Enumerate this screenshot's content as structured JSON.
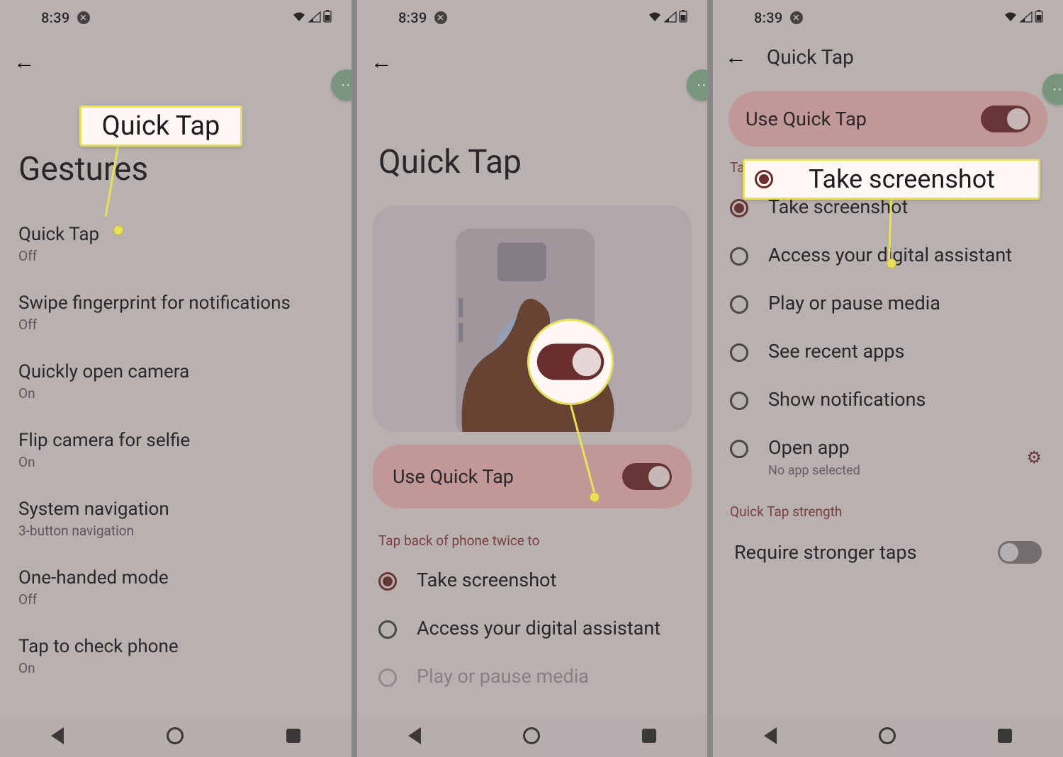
{
  "status_time": "8:39",
  "panel1": {
    "title": "Gestures",
    "items": [
      {
        "title": "Quick Tap",
        "sub": "Off"
      },
      {
        "title": "Swipe fingerprint for notifications",
        "sub": "Off"
      },
      {
        "title": "Quickly open camera",
        "sub": "On"
      },
      {
        "title": "Flip camera for selfie",
        "sub": "On"
      },
      {
        "title": "System navigation",
        "sub": "3-button navigation"
      },
      {
        "title": "One-handed mode",
        "sub": "Off"
      },
      {
        "title": "Tap to check phone",
        "sub": "On"
      }
    ],
    "callout_label": "Quick Tap"
  },
  "panel2": {
    "title": "Quick Tap",
    "use_label": "Use Quick Tap",
    "section": "Tap back of phone twice to",
    "options": [
      {
        "label": "Take screenshot",
        "selected": true
      },
      {
        "label": "Access your digital assistant",
        "selected": false
      },
      {
        "label": "Play or pause media",
        "selected": false
      }
    ]
  },
  "panel3": {
    "appbar_title": "Quick Tap",
    "use_label": "Use Quick Tap",
    "section": "Tap back of phone twice to",
    "options": [
      {
        "label": "Take screenshot",
        "selected": true
      },
      {
        "label": "Access your digital assistant",
        "selected": false
      },
      {
        "label": "Play or pause media",
        "selected": false
      },
      {
        "label": "See recent apps",
        "selected": false
      },
      {
        "label": "Show notifications",
        "selected": false
      },
      {
        "label": "Open app",
        "sub": "No app selected",
        "selected": false,
        "gear": true
      }
    ],
    "strength_hdr": "Quick Tap strength",
    "stronger_label": "Require stronger taps",
    "callout_label": "Take screenshot"
  }
}
